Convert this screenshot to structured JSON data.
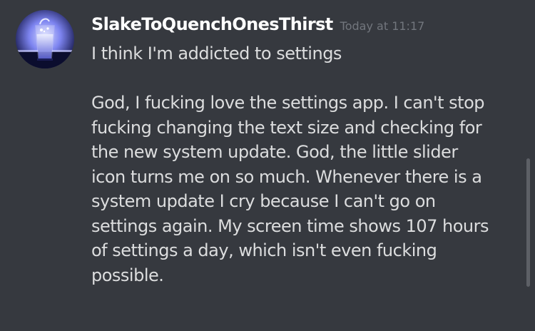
{
  "message": {
    "author": "SlakeToQuenchOnesThirst",
    "timestamp": "Today at 11:17",
    "first_line": "I think I'm addicted to settings",
    "body_lines": [
      "God, I fucking love the settings app. I can't stop",
      "fucking changing the text size and checking for",
      "the new system update. God, the little slider",
      "icon turns me on so much. Whenever there is a",
      "system update I cry because I can't go on",
      "settings again. My screen time shows 107 hours",
      "of settings a day, which isn't even fucking",
      "possible."
    ]
  },
  "avatar": {
    "icon": "glass-of-water-icon"
  },
  "colors": {
    "background": "#36393f",
    "username": "#ffffff",
    "timestamp": "#72767d",
    "message_text": "#dcddde",
    "scrollbar": "#5d6066"
  }
}
